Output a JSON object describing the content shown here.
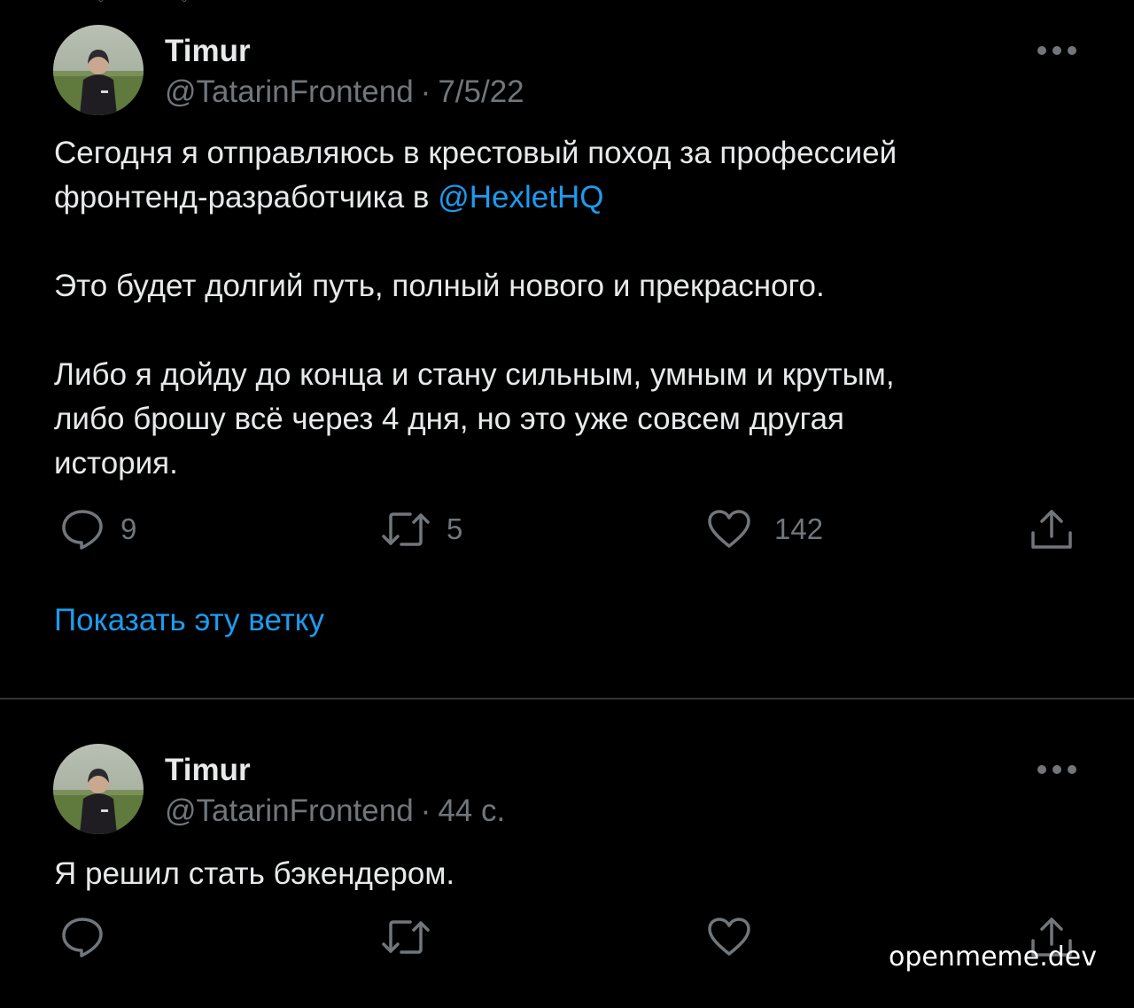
{
  "tweets": [
    {
      "author_name": "Timur",
      "handle": "@TatarinFrontend",
      "separator": "·",
      "time": "7/5/22",
      "paragraphs": [
        {
          "line1": "Сегодня я отправляюсь в крестовый поход за профессией",
          "line2_prefix": "фронтенд-разработчика в ",
          "mention": "@HexletHQ"
        },
        "Это будет долгий путь, полный нового и прекрасного.",
        [
          "Либо я дойду до конца и стану сильным, умным и крутым,",
          "либо брошу всё через 4 дня, но это уже совсем другая",
          "история."
        ]
      ],
      "actions": {
        "replies": "9",
        "retweets": "5",
        "likes": "142"
      },
      "show_thread": "Показать эту ветку"
    },
    {
      "author_name": "Timur",
      "handle": "@TatarinFrontend",
      "separator": "·",
      "time": "44 с.",
      "text": "Я решил стать бэкендером."
    }
  ],
  "watermark": "openmeme.dev",
  "icons": [
    "more-icon",
    "reply-icon",
    "retweet-icon",
    "like-icon",
    "share-icon"
  ],
  "colors": {
    "background": "#000000",
    "text": "#e7e9ea",
    "muted": "#71767b",
    "accent": "#1d9bf0",
    "divider": "#2f3336"
  }
}
